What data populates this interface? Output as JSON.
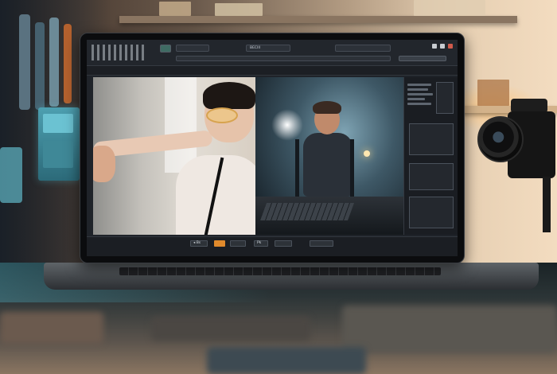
{
  "scene": {
    "description_free": true,
    "accent_colors": {
      "app_bg": "#1f2329",
      "highlight": "#e08a2c",
      "screen_glow": "#4d9fb0"
    }
  },
  "app": {
    "topbar": {
      "label_1": "",
      "label_2": "BECIII",
      "label_3": "",
      "label_4": ""
    },
    "transport": {
      "btn_1": "◂ Bs",
      "btn_2": "",
      "btn_3": "Pk",
      "btn_4": "",
      "btn_5": "",
      "btn_6": ""
    },
    "icons": [
      "menu-grid-icon",
      "play-icon",
      "record-icon",
      "settings-icon",
      "minimize-icon",
      "maximize-icon",
      "close-icon"
    ]
  }
}
